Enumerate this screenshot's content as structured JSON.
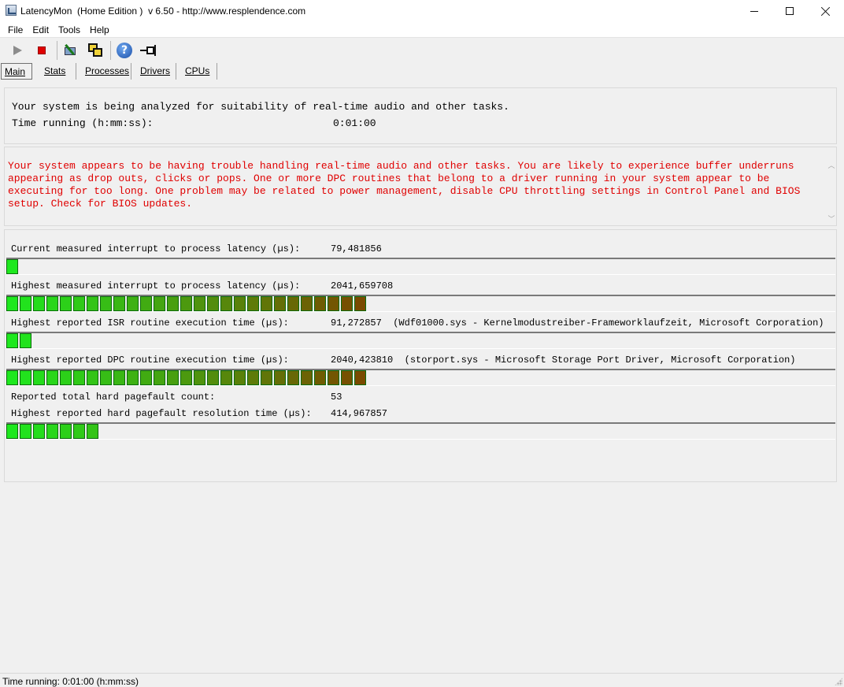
{
  "window": {
    "title": "LatencyMon  (Home Edition )  v 6.50 - http://www.resplendence.com"
  },
  "menu": [
    {
      "label": "File"
    },
    {
      "label": "Edit"
    },
    {
      "label": "Tools"
    },
    {
      "label": "Help"
    }
  ],
  "toolbar": {
    "icons": [
      "play-icon",
      "stop-icon",
      "tools-icon",
      "windows-icon",
      "help-icon",
      "pin-icon"
    ]
  },
  "tabs": [
    {
      "label": "Main",
      "selected": true
    },
    {
      "label": "Stats",
      "selected": false
    },
    {
      "label": "Processes",
      "selected": false
    },
    {
      "label": "Drivers",
      "selected": false
    },
    {
      "label": "CPUs",
      "selected": false
    }
  ],
  "status_panel": {
    "line1": "Your system is being analyzed for suitability of real-time audio and other tasks.",
    "time_label": "Time running (h:mm:ss):",
    "time_value": "0:01:00"
  },
  "warning": {
    "text": "Your system appears to be having trouble handling real-time audio and other tasks. You are likely to experience buffer underruns appearing as drop outs, clicks or pops. One or more DPC routines that belong to a driver running in your system appear to be executing for too long. One problem may be related to power management, disable CPU throttling settings in Control Panel and BIOS setup. Check for BIOS updates.",
    "color": "#e00000"
  },
  "metrics": [
    {
      "label": "Current measured interrupt to process latency (µs):",
      "value": "79,481856",
      "bar_segments": 1
    },
    {
      "label": "Highest measured interrupt to process latency (µs):",
      "value": "2041,659708",
      "bar_segments": 27
    },
    {
      "label": "Highest reported ISR routine execution time (µs):",
      "value": "91,272857  (Wdf01000.sys - Kernelmodustreiber-Frameworklaufzeit, Microsoft Corporation)",
      "bar_segments": 2
    },
    {
      "label": "Highest reported DPC routine execution time (µs):",
      "value": "2040,423810  (storport.sys - Microsoft Storage Port Driver, Microsoft Corporation)",
      "bar_segments": 27
    },
    {
      "label": "Reported total hard pagefault count:",
      "value": "53"
    },
    {
      "label": "Highest reported hard pagefault resolution time (µs):",
      "value": "414,967857",
      "bar_segments": 7
    }
  ],
  "bar_colors": {
    "start": "#1ee81e",
    "end": "#7a4a00"
  },
  "statusbar": {
    "text": "Time running: 0:01:00  (h:mm:ss)"
  }
}
